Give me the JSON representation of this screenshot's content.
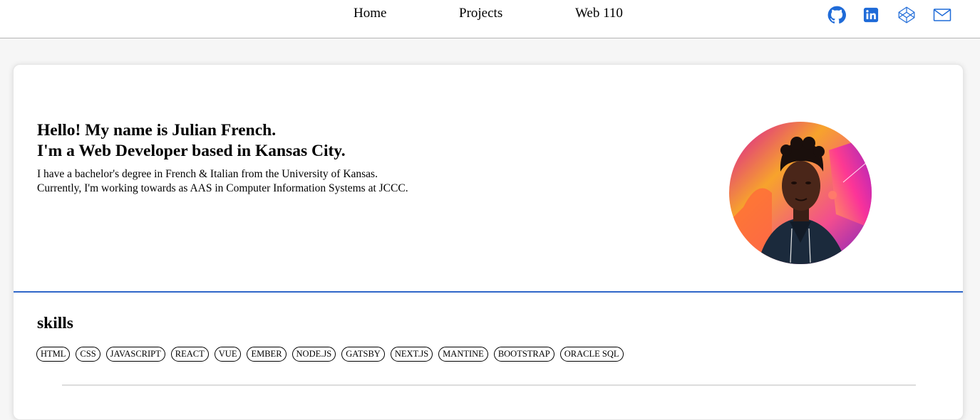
{
  "nav": {
    "items": [
      {
        "label": "Home"
      },
      {
        "label": "Projects"
      },
      {
        "label": "Web 110"
      }
    ],
    "social": [
      {
        "icon": "github-icon"
      },
      {
        "icon": "linkedin-icon"
      },
      {
        "icon": "codepen-icon"
      },
      {
        "icon": "mail-icon"
      }
    ]
  },
  "hero": {
    "headline_line1": "Hello! My name is Julian French.",
    "headline_line2": "I'm a Web Developer based in Kansas City.",
    "bio_line1": "I have a bachelor's degree in French & Italian from the University of Kansas.",
    "bio_line2": "Currently, I'm working towards as AAS in Computer Information Systems at JCCC."
  },
  "skills": {
    "title": "skills",
    "items": [
      "HTML",
      "CSS",
      "JAVASCRIPT",
      "REACT",
      "VUE",
      "EMBER",
      "NODE.JS",
      "GATSBY",
      "NEXT.JS",
      "MANTINE",
      "BOOTSTRAP",
      "ORACLE SQL"
    ]
  },
  "colors": {
    "accent": "#2f66c8",
    "icon_blue": "#1f6bd8"
  }
}
